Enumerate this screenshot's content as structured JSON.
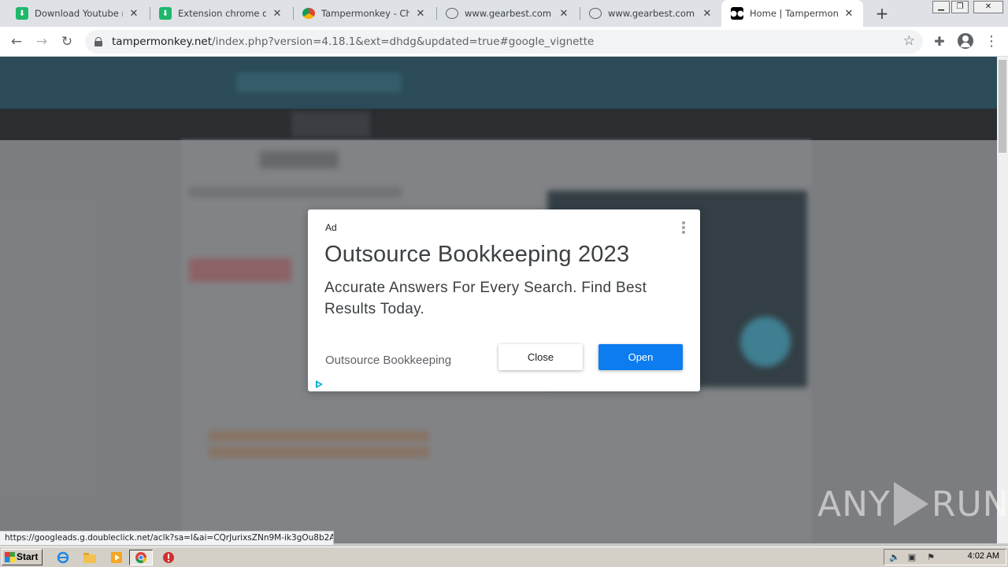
{
  "browser": {
    "tabs": [
      {
        "title": "Download Youtube mp3,",
        "favicon": "download-icon"
      },
      {
        "title": "Extension chrome downl",
        "favicon": "download-icon"
      },
      {
        "title": "Tampermonkey - Chrom",
        "favicon": "chrome-webstore-icon"
      },
      {
        "title": "www.gearbest.com",
        "favicon": "globe-icon"
      },
      {
        "title": "www.gearbest.com",
        "favicon": "globe-icon"
      },
      {
        "title": "Home | Tampermonkey",
        "favicon": "tampermonkey-icon",
        "active": true
      }
    ],
    "new_tab": "+",
    "url_host": "tampermonkey.net",
    "url_path": "/index.php?version=4.18.1&ext=dhdg&updated=true#google_vignette"
  },
  "ad": {
    "label": "Ad",
    "headline": "Outsource Bookkeeping 2023",
    "description": "Accurate Answers For Every Search. Find Best Results Today.",
    "advertiser": "Outsource Bookkeeping",
    "close_label": "Close",
    "open_label": "Open",
    "open_color": "#0c7cf0"
  },
  "status_link": "https://googleads.g.doubleclick.net/aclk?sa=l&ai=CQrJurixsZNn9M-ik3gOu8b2ACIm...",
  "watermark": {
    "left": "ANY",
    "right": "RUN"
  },
  "taskbar": {
    "start_label": "Start",
    "clock": "4:02 AM"
  },
  "colors": {
    "header": "#1f4a5a",
    "accent": "#1a73e8"
  }
}
